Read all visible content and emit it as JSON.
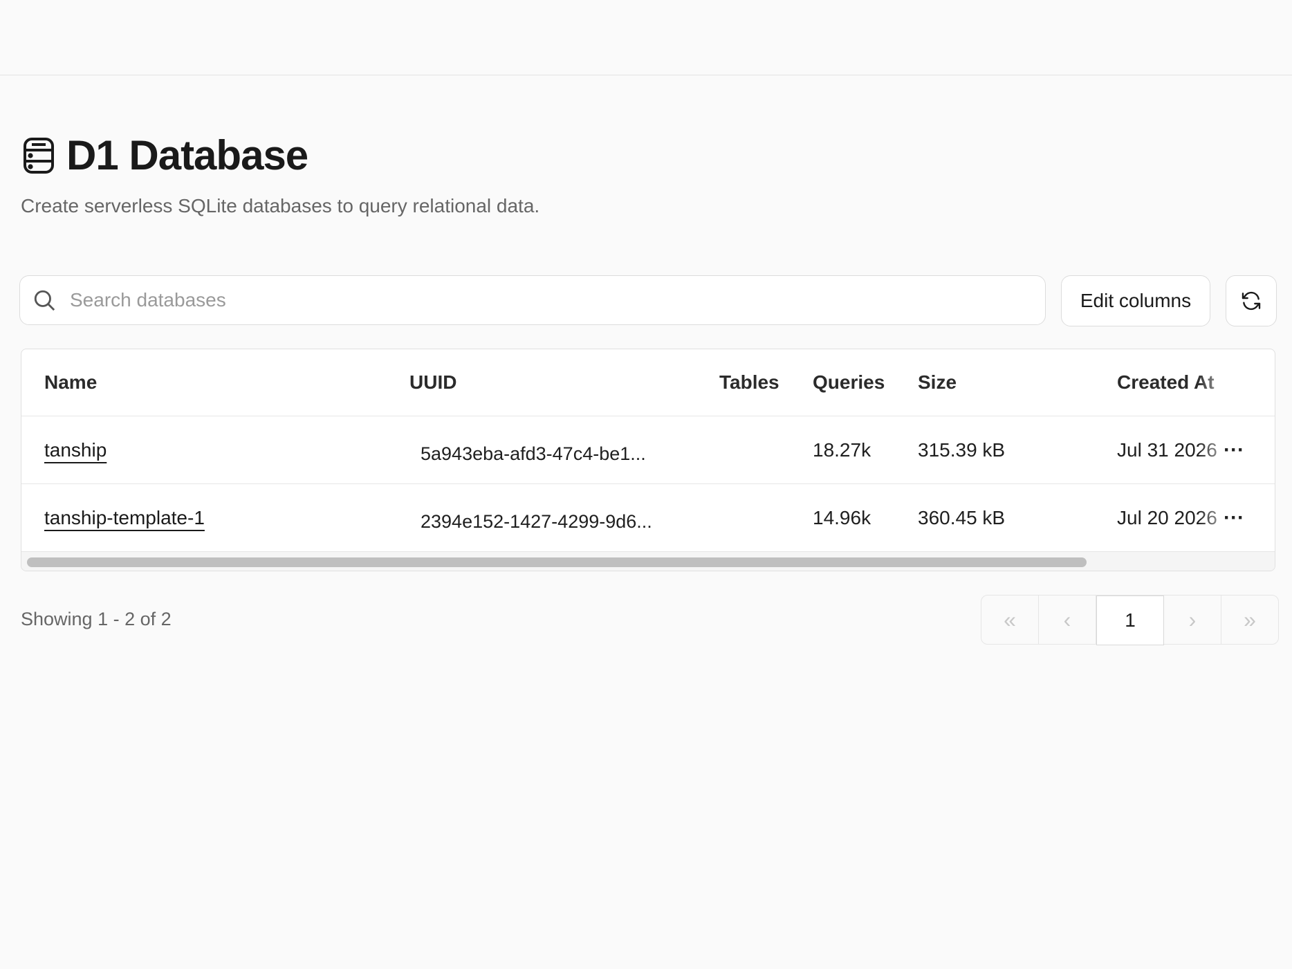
{
  "page": {
    "title": "D1 Database",
    "subtitle": "Create serverless SQLite databases to query relational data."
  },
  "toolbar": {
    "search_placeholder": "Search databases",
    "edit_columns_label": "Edit columns"
  },
  "table": {
    "headers": {
      "name": "Name",
      "uuid": "UUID",
      "tables": "Tables",
      "queries": "Queries",
      "size": "Size",
      "created_at": "Created At"
    },
    "rows": [
      {
        "name": "tanship",
        "uuid": "5a943eba-afd3-47c4-be1...",
        "tables": "",
        "queries": "18.27k",
        "size": "315.39 kB",
        "created_at": "Jul 31 2026"
      },
      {
        "name": "tanship-template-1",
        "uuid": "2394e152-1427-4299-9d6...",
        "tables": "",
        "queries": "14.96k",
        "size": "360.45 kB",
        "created_at": "Jul 20 2026"
      }
    ]
  },
  "footer": {
    "showing_text": "Showing 1 - 2 of 2",
    "current_page": "1"
  },
  "icons": {
    "title": "database-icon",
    "search": "search-icon",
    "refresh": "refresh-icon",
    "row_menu": "more-horizontal-icon",
    "first": "chevrons-left-icon",
    "prev": "chevron-left-icon",
    "next": "chevron-right-icon",
    "last": "chevrons-right-icon"
  }
}
